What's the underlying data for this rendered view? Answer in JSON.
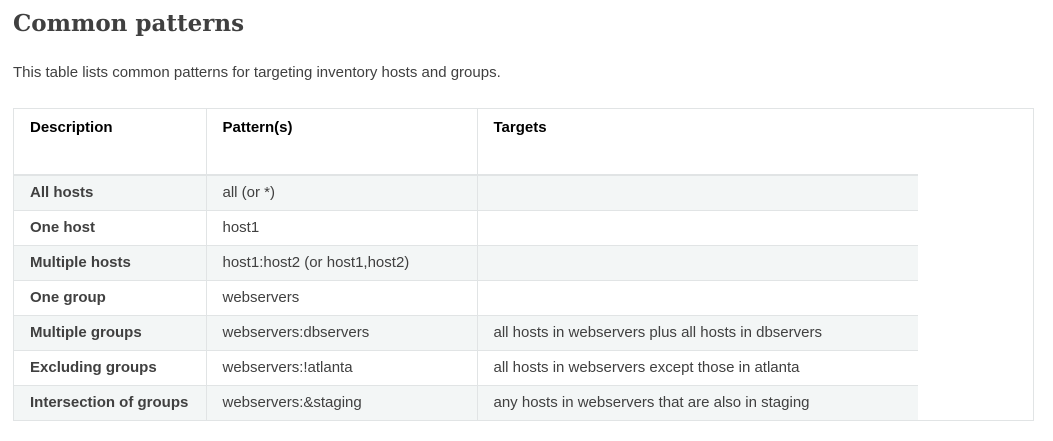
{
  "heading": "Common patterns",
  "intro": "This table lists common patterns for targeting inventory hosts and groups.",
  "table": {
    "headers": [
      "Description",
      "Pattern(s)",
      "Targets"
    ],
    "rows": [
      {
        "description": "All hosts",
        "pattern": "all (or *)",
        "targets": ""
      },
      {
        "description": "One host",
        "pattern": "host1",
        "targets": ""
      },
      {
        "description": "Multiple hosts",
        "pattern": "host1:host2 (or host1,host2)",
        "targets": ""
      },
      {
        "description": "One group",
        "pattern": "webservers",
        "targets": ""
      },
      {
        "description": "Multiple groups",
        "pattern": "webservers:dbservers",
        "targets": "all hosts in webservers plus all hosts in dbservers"
      },
      {
        "description": "Excluding groups",
        "pattern": "webservers:!atlanta",
        "targets": "all hosts in webservers except those in atlanta"
      },
      {
        "description": "Intersection of groups",
        "pattern": "webservers:&staging",
        "targets": "any hosts in webservers that are also in staging"
      }
    ]
  }
}
